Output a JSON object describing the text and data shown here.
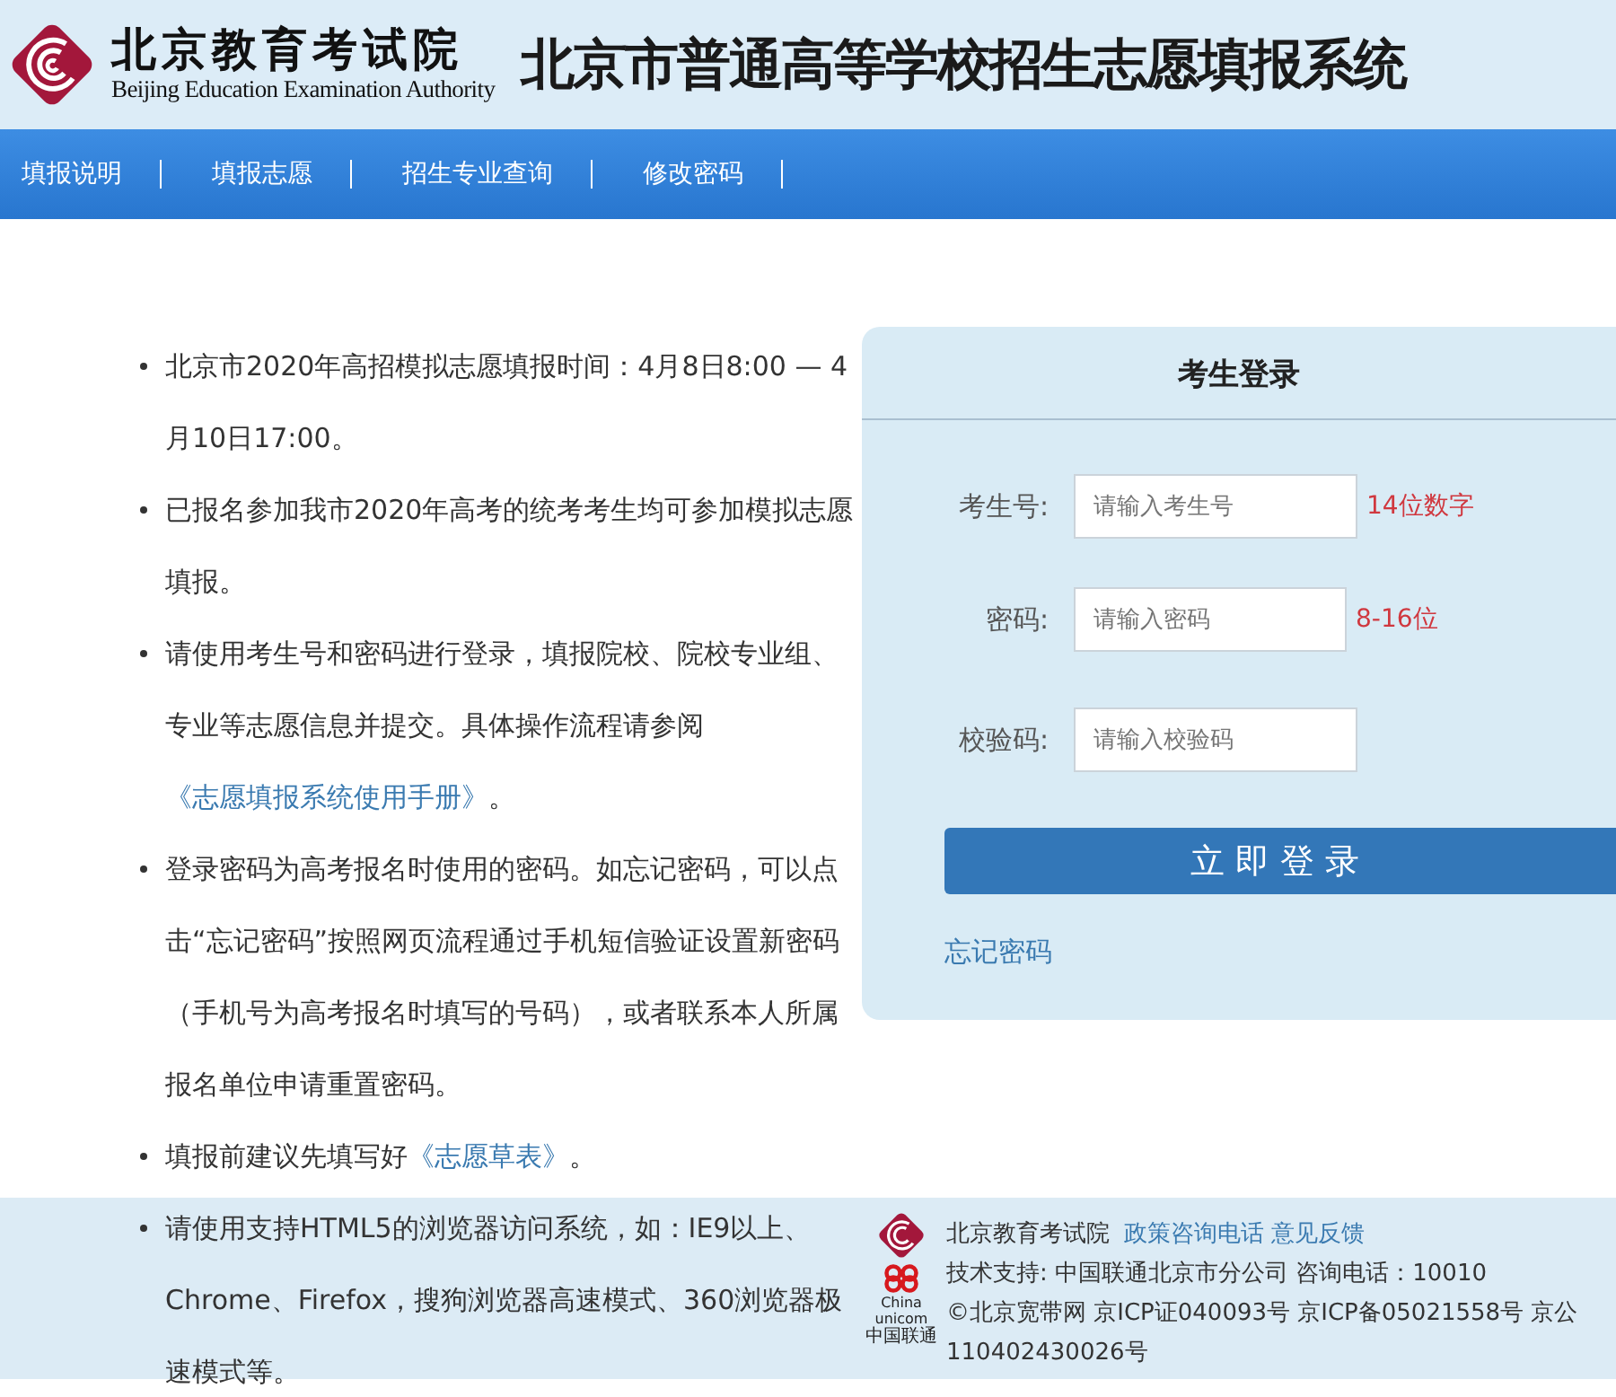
{
  "header": {
    "org_name": "北京教育考试院",
    "org_name_en": "Beijing Education Examination Authority",
    "system_title": "北京市普通高等学校招生志愿填报系统"
  },
  "nav": [
    {
      "label": "填报说明"
    },
    {
      "label": "填报志愿"
    },
    {
      "label": "招生专业查询"
    },
    {
      "label": "修改密码"
    }
  ],
  "notices": [
    {
      "parts": [
        {
          "kind": "text",
          "text": "北京市2020年高招模拟志愿填报时间：4月8日8:00 — 4月10日17:00。"
        }
      ]
    },
    {
      "parts": [
        {
          "kind": "text",
          "text": "已报名参加我市2020年高考的统考考生均可参加模拟志愿填报。"
        }
      ]
    },
    {
      "parts": [
        {
          "kind": "text",
          "text": "请使用考生号和密码进行登录，填报院校、院校专业组、专业等志愿信息并提交。具体操作流程请参阅 "
        },
        {
          "kind": "link",
          "text": "《志愿填报系统使用手册》"
        },
        {
          "kind": "text",
          "text": "。"
        }
      ]
    },
    {
      "parts": [
        {
          "kind": "text",
          "text": "登录密码为高考报名时使用的密码。如忘记密码，可以点击“忘记密码”按照网页流程通过手机短信验证设置新密码（手机号为高考报名时填写的号码），或者联系本人所属报名单位申请重置密码。"
        }
      ]
    },
    {
      "parts": [
        {
          "kind": "text",
          "text": "填报前建议先填写好"
        },
        {
          "kind": "link",
          "text": "《志愿草表》"
        },
        {
          "kind": "text",
          "text": "。"
        }
      ]
    },
    {
      "parts": [
        {
          "kind": "text",
          "text": "请使用支持HTML5的浏览器访问系统，如：IE9以上、Chrome、Firefox，搜狗浏览器高速模式、360浏览器极速模式等。"
        }
      ]
    }
  ],
  "login": {
    "title": "考生登录",
    "fields": [
      {
        "label": "考生号:",
        "placeholder": "请输入考生号",
        "hint": "14位数字"
      },
      {
        "label": "密码:",
        "placeholder": "请输入密码",
        "hint": "8-16位"
      },
      {
        "label": "校验码:",
        "placeholder": "请输入校验码"
      }
    ],
    "submit": "立即登录",
    "forgot": "忘记密码"
  },
  "footer": {
    "unicom_logo": {
      "latin": "China unicom",
      "chinese": "中国联通"
    },
    "org": "北京教育考试院",
    "links": [
      "政策咨询电话",
      "意见反馈"
    ],
    "support": "技术支持: 中国联通北京市分公司 咨询电话：10010",
    "license_lines": [
      "©北京宽带网 京ICP证040093号 京ICP备05021558号 京公",
      "110402430026号"
    ]
  }
}
